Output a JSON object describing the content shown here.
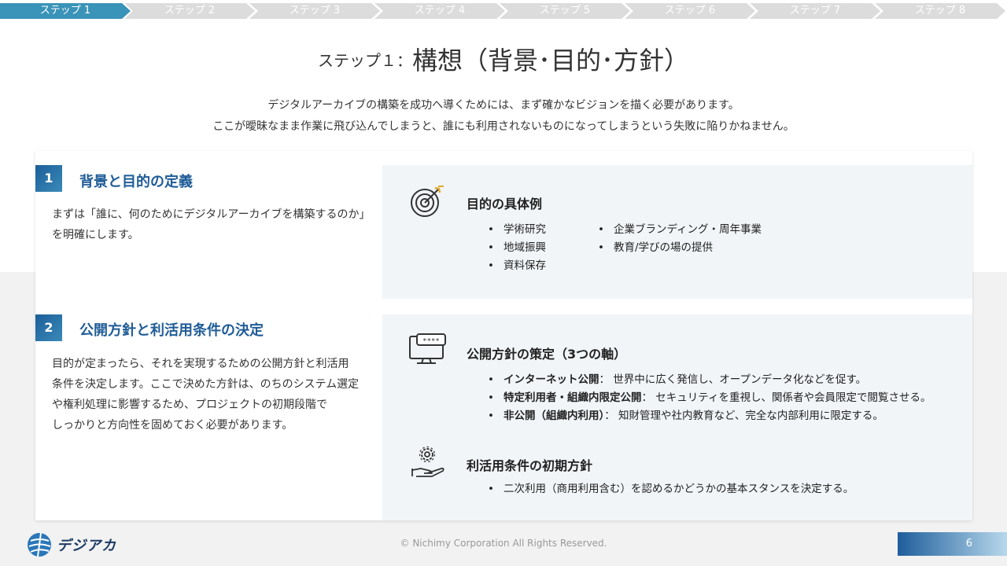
{
  "steps": [
    "ステップ 1",
    "ステップ 2",
    "ステップ 3",
    "ステップ 4",
    "ステップ 5",
    "ステップ 6",
    "ステップ 7",
    "ステップ 8"
  ],
  "active_step": 0,
  "title": {
    "prefix": "ステップ１：",
    "main": "構想（背景･目的･方針）"
  },
  "intro": [
    "デジタルアーカイブの構築を成功へ導くためには、まず確かなビジョンを描く必要があります。",
    "ここが曖昧なまま作業に飛び込んでしまうと、誰にも利用されないものになってしまうという失敗に陥りかねません。"
  ],
  "section1": {
    "number": "1",
    "title": "背景と目的の定義",
    "desc": [
      "まずは「誰に、何のためにデジタルアーカイブを構築するのか」",
      "を明確にします。"
    ]
  },
  "section2": {
    "number": "2",
    "title": "公開方針と利活用条件の決定",
    "desc": [
      "目的が定まったら、それを実現するための公開方針と利活用",
      "条件を決定します。ここで決めた方針は、のちのシステム選定",
      "や権利処理に影響するため、プロジェクトの初期段階で",
      "しっかりと方向性を固めておく必要があります。"
    ]
  },
  "panel1": {
    "title": "目的の具体例",
    "icon": "target-icon",
    "col1": [
      "学術研究",
      "地域振興",
      "資料保存"
    ],
    "col2": [
      "企業ブランディング・周年事業",
      "教育/学びの場の提供"
    ]
  },
  "panel2": {
    "title": "公開方針の策定（3つの軸）",
    "icon": "password-monitor-icon",
    "items": [
      {
        "label": "インターネット公開",
        "sep": "： ",
        "text": "世界中に広く発信し、オープンデータ化などを促す。"
      },
      {
        "label": "特定利用者・組織内限定公開",
        "sep": "： ",
        "text": "セキュリティを重視し、関係者や会員限定で閲覧させる。"
      },
      {
        "label": "非公開（組織内利用）",
        "sep": "： ",
        "text": "知財管理や社内教育など、完全な内部利用に限定する。"
      }
    ]
  },
  "panel3": {
    "title": "利活用条件の初期方針",
    "icon": "gear-hand-icon",
    "items": [
      "二次利用（商用利用含む）を認めるかどうかの基本スタンスを決定する。"
    ]
  },
  "footer": {
    "logo_text": "デジアカ",
    "copyright": "© Nichimy Corporation All Rights Reserved.",
    "page": "6"
  },
  "colors": {
    "accent": "#1f5c97",
    "step_active": "#3a93b8",
    "step_inactive": "#dcdcdc",
    "panel_bg": "#f1f5f8"
  }
}
